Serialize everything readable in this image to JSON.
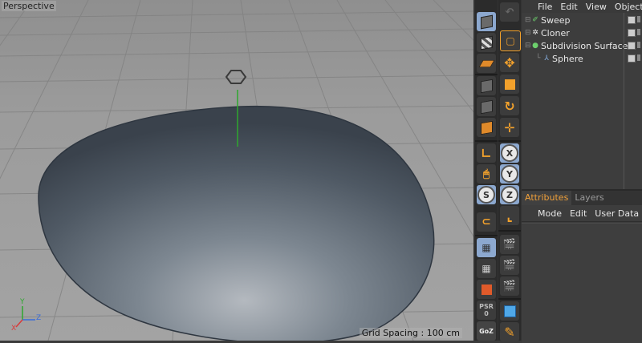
{
  "viewport": {
    "label": "Perspective",
    "grid_spacing": "Grid Spacing : 100 cm",
    "axis_labels": {
      "x": "X",
      "y": "Y",
      "z": "Z"
    }
  },
  "object_manager": {
    "menu": [
      "File",
      "Edit",
      "View",
      "Objects"
    ],
    "items": [
      {
        "name": "Sweep",
        "icon": "sweep-icon"
      },
      {
        "name": "Cloner",
        "icon": "cloner-icon"
      },
      {
        "name": "Subdivision Surface",
        "icon": "subdivision-surface-icon"
      },
      {
        "name": "Sphere",
        "icon": "sphere-icon"
      }
    ]
  },
  "attributes": {
    "tabs": [
      "Attributes",
      "Layers"
    ],
    "menu": [
      "Mode",
      "Edit",
      "User Data"
    ]
  },
  "toolbar": {
    "axis_buttons": [
      "X",
      "Y",
      "Z"
    ],
    "s_button": "S",
    "psr_label": "PSR",
    "psr_value": "0",
    "goz_label": "GoZ"
  },
  "colors": {
    "accent": "#f0a03a",
    "selected_blue": "#8ca8cf",
    "y_axis": "#2ea82e",
    "shape": "#5a6470"
  }
}
